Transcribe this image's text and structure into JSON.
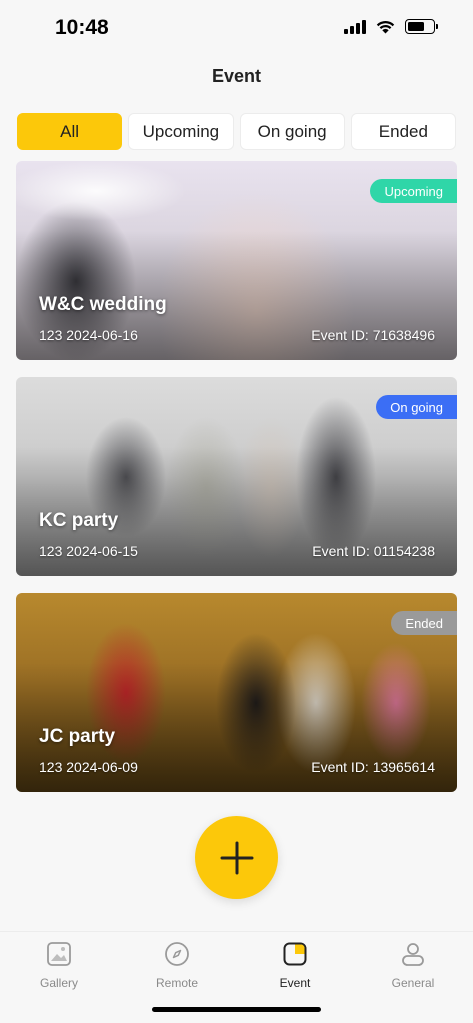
{
  "status_bar": {
    "time": "10:48"
  },
  "header": {
    "title": "Event"
  },
  "filters": [
    {
      "label": "All",
      "active": true
    },
    {
      "label": "Upcoming",
      "active": false
    },
    {
      "label": "On going",
      "active": false
    },
    {
      "label": "Ended",
      "active": false
    }
  ],
  "events": [
    {
      "title": "W&C wedding",
      "meta": "123  2024-06-16",
      "event_id": "Event ID: 71638496",
      "status": "Upcoming",
      "status_color": "#2fd6a8"
    },
    {
      "title": "KC party",
      "meta": "123  2024-06-15",
      "event_id": "Event ID: 01154238",
      "status": "On going",
      "status_color": "#3b6ef5"
    },
    {
      "title": "JC party",
      "meta": "123  2024-06-09",
      "event_id": "Event ID: 13965614",
      "status": "Ended",
      "status_color": "#9a9a9a"
    }
  ],
  "fab": {
    "icon": "plus-icon",
    "color": "#fcc80a"
  },
  "bottom_nav": [
    {
      "label": "Gallery",
      "icon": "gallery-icon",
      "active": false
    },
    {
      "label": "Remote",
      "icon": "compass-icon",
      "active": false
    },
    {
      "label": "Event",
      "icon": "event-icon",
      "active": true
    },
    {
      "label": "General",
      "icon": "person-icon",
      "active": false
    }
  ],
  "colors": {
    "accent": "#fcc80a",
    "background": "#f7f7f7"
  }
}
